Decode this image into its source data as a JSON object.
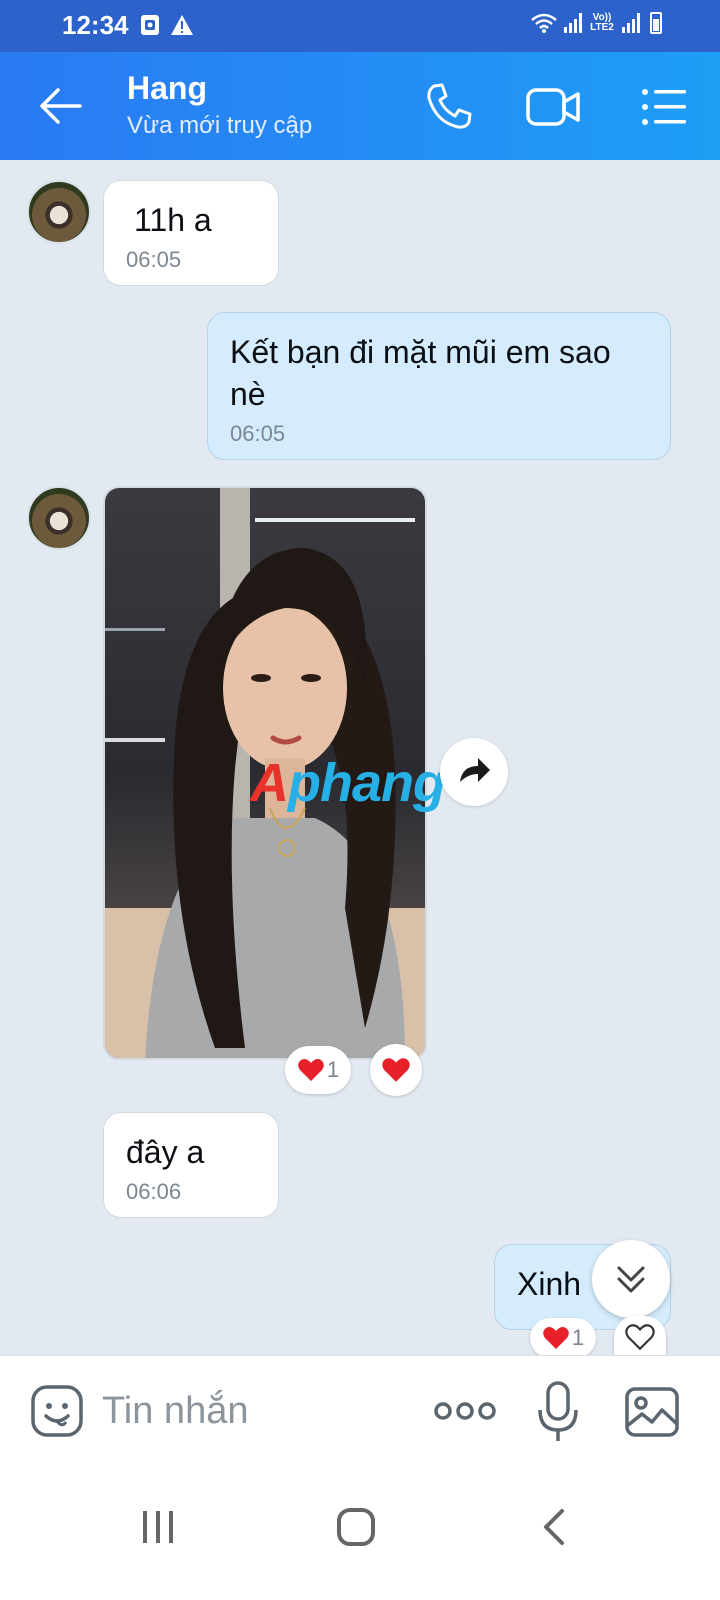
{
  "status_bar": {
    "time": "12:34",
    "lte_label": "Vo)) LTE2"
  },
  "header": {
    "contact_name": "Hang",
    "contact_status": "Vừa mới truy cập"
  },
  "messages": [
    {
      "direction": "incoming",
      "text": "11h a",
      "time": "06:05"
    },
    {
      "direction": "outgoing",
      "text": "Kết bạn đi mặt mũi em sao nè",
      "time": "06:05"
    },
    {
      "direction": "incoming",
      "type": "photo",
      "reaction_icon": "heart",
      "reaction_count": "1"
    },
    {
      "direction": "incoming",
      "text": "đây a",
      "time": "06:06"
    },
    {
      "direction": "outgoing",
      "text": "Xinh",
      "reaction_icon": "heart",
      "reaction_count": "1"
    }
  ],
  "watermark": {
    "part1": "A",
    "part2": "phang"
  },
  "composer": {
    "placeholder": "Tin nhắn"
  },
  "colors": {
    "header_gradient_start": "#2a7af3",
    "header_gradient_end": "#1e9ef5",
    "status_bar": "#2c62c9",
    "chat_bg": "#e2e9f1",
    "outgoing_bubble": "#d4ecfd",
    "incoming_bubble": "#ffffff",
    "heart": "#e8202a"
  },
  "icons": [
    "back-arrow-icon",
    "phone-icon",
    "video-camera-icon",
    "list-menu-icon",
    "forward-icon",
    "heart-icon",
    "heart-outline-icon",
    "double-chevron-down-icon",
    "sticker-icon",
    "more-dots-icon",
    "microphone-icon",
    "image-icon",
    "recent-apps-icon",
    "home-icon",
    "back-icon"
  ]
}
